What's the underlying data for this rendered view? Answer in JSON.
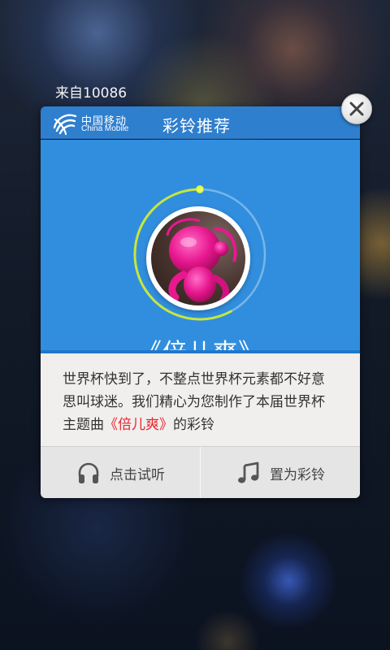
{
  "notification": {
    "source": "来自10086"
  },
  "card": {
    "logo": {
      "cn": "中国移动",
      "en": "China Mobile"
    },
    "header_title": "彩铃推荐",
    "song_title": "《倍儿爽》",
    "description": {
      "before": "世界杯快到了，不整点世界杯元素都不好意思叫球迷。我们精心为您制作了本届世界杯主题曲",
      "highlight": "《倍儿爽》",
      "after": "的彩铃"
    },
    "actions": {
      "listen_label": "点击试听",
      "set_ringtone_label": "置为彩铃"
    }
  },
  "icons": {
    "close": "close-icon",
    "listen": "headphones-icon",
    "set_ringtone": "music-note-icon",
    "logo": "china-mobile-logo"
  },
  "colors": {
    "header": "#2f7fcf",
    "hero": "#318ede",
    "body_bg": "#f1eeee",
    "highlight": "#e8262b",
    "progress_ring": "#c8e63c"
  },
  "playback_progress": 0.58
}
